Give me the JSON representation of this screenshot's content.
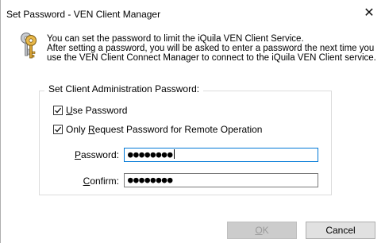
{
  "window": {
    "title": "Set Password - VEN Client Manager",
    "close_glyph": "✕"
  },
  "info": {
    "icon": "keys-icon",
    "line1": "You can set the password to limit the iQuila VEN Client Service.",
    "line2": "After setting a password, you will be asked to enter a password the next time you",
    "line3": "use the VEN Client Connect Manager to connect to the iQuila VEN Client service."
  },
  "group": {
    "legend": "Set Client Administration Password:",
    "use_password": {
      "label_prefix": "",
      "label_mnemonic": "U",
      "label_rest": "se Password",
      "checked": true
    },
    "remote_only": {
      "label_prefix": "Only ",
      "label_mnemonic": "R",
      "label_rest": "equest Password for Remote Operation",
      "checked": true
    },
    "password": {
      "label_mnemonic": "P",
      "label_rest": "assword:",
      "value": "●●●●●●●●"
    },
    "confirm": {
      "label_mnemonic": "C",
      "label_rest": "onfirm:",
      "value": "●●●●●●●●"
    }
  },
  "buttons": {
    "ok_mnemonic": "O",
    "ok_rest": "K",
    "ok_enabled": false,
    "cancel": "Cancel"
  },
  "colors": {
    "focus_border": "#0078d7",
    "disabled_text": "#9a9a9a"
  }
}
